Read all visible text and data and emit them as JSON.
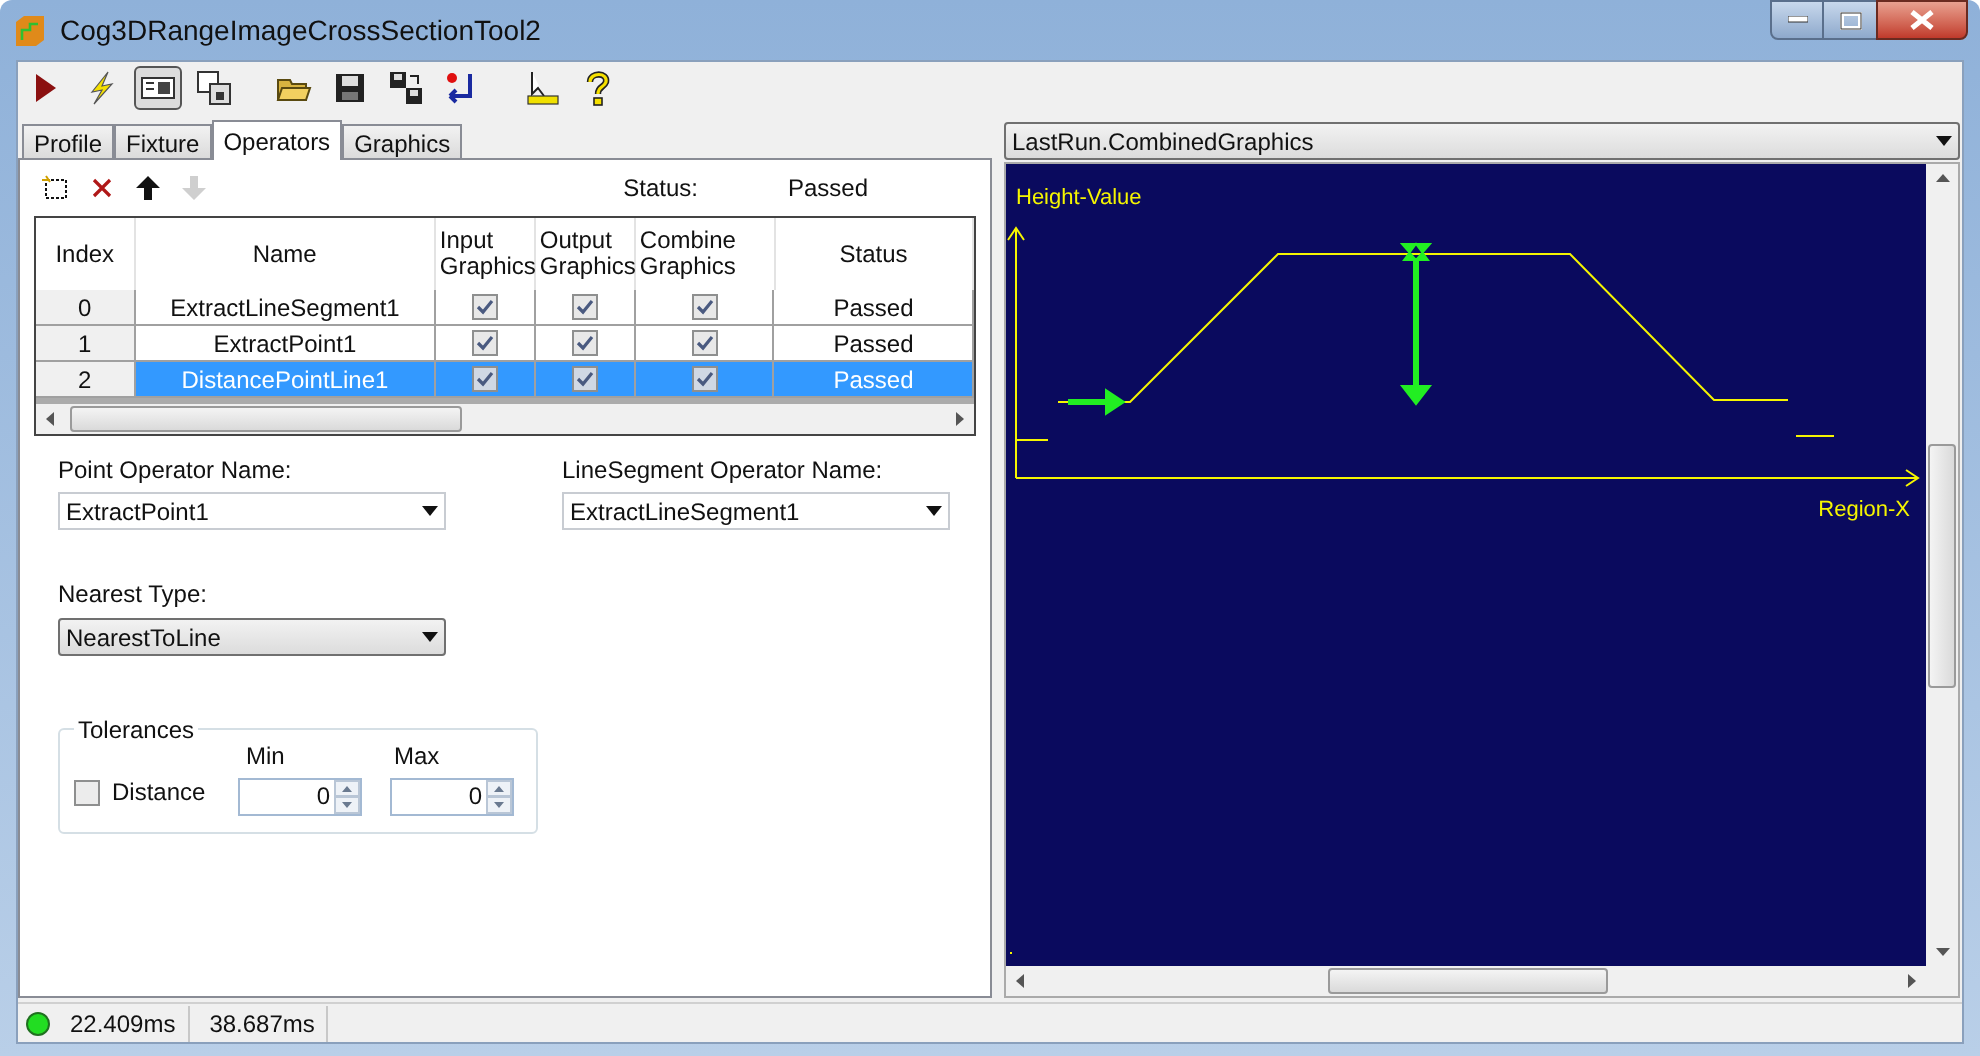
{
  "window": {
    "title": "Cog3DRangeImageCrossSectionTool2"
  },
  "toolbar": [
    {
      "kind": "run",
      "pressed": false
    },
    {
      "kind": "bolt",
      "pressed": false
    },
    {
      "kind": "panel",
      "pressed": true
    },
    {
      "kind": "float",
      "pressed": false
    },
    {
      "kind": "open",
      "pressed": false
    },
    {
      "kind": "save",
      "pressed": false
    },
    {
      "kind": "saveas",
      "pressed": false
    },
    {
      "kind": "reset",
      "pressed": false
    },
    {
      "kind": "cursor",
      "pressed": false
    },
    {
      "kind": "help",
      "pressed": false
    }
  ],
  "tabs": [
    {
      "label": "Profile",
      "selected": false
    },
    {
      "label": "Fixture",
      "selected": false
    },
    {
      "label": "Operators",
      "selected": true
    },
    {
      "label": "Graphics",
      "selected": false
    }
  ],
  "operator_toolbar": {
    "buttons": [
      {
        "kind": "new",
        "disabled": false
      },
      {
        "kind": "delete",
        "disabled": false
      },
      {
        "kind": "up",
        "disabled": false
      },
      {
        "kind": "down",
        "disabled": true
      }
    ],
    "status_label": "Status:",
    "status_value": "Passed"
  },
  "table": {
    "columns": [
      "Index",
      "Name",
      "Input Graphics",
      "Output Graphics",
      "Combine Graphics",
      "Status"
    ],
    "rows": [
      {
        "index": "0",
        "name": "ExtractLineSegment1",
        "input_graphics": true,
        "output_graphics": true,
        "combine_graphics": true,
        "status": "Passed",
        "selected": false
      },
      {
        "index": "1",
        "name": "ExtractPoint1",
        "input_graphics": true,
        "output_graphics": true,
        "combine_graphics": true,
        "status": "Passed",
        "selected": false
      },
      {
        "index": "2",
        "name": "DistancePointLine1",
        "input_graphics": true,
        "output_graphics": true,
        "combine_graphics": true,
        "status": "Passed",
        "selected": true
      }
    ]
  },
  "point_operator": {
    "label": "Point Operator Name:",
    "value": "ExtractPoint1"
  },
  "line_segment_operator": {
    "label": "LineSegment Operator Name:",
    "value": "ExtractLineSegment1"
  },
  "nearest_type": {
    "label": "Nearest Type:",
    "value": "NearestToLine"
  },
  "tolerances": {
    "title": "Tolerances",
    "distance": {
      "label": "Distance",
      "checked": false
    },
    "min": {
      "label": "Min",
      "value": "0"
    },
    "max": {
      "label": "Max",
      "value": "0"
    }
  },
  "graphics": {
    "selector": "LastRun.CombinedGraphics",
    "y_label": "Height-Value",
    "x_label": "Region-X"
  },
  "status_bar": {
    "ok": true,
    "times": [
      "22.409ms",
      "38.687ms"
    ]
  }
}
